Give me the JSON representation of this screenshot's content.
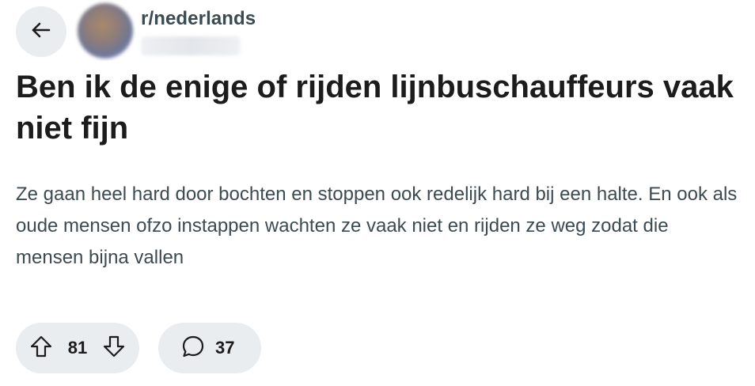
{
  "header": {
    "back_icon": "arrow-left-icon",
    "subreddit": "r/nederlands",
    "username": ""
  },
  "post": {
    "title": "Ben ik de enige of rijden lijnbuschauffeurs vaak niet fijn",
    "body": "Ze gaan heel hard door bochten en stoppen ook redelijk hard bij een halte. En ook als oude mensen ofzo instappen wachten ze vaak niet en rijden ze weg zodat die mensen bijna vallen"
  },
  "actions": {
    "upvote_icon": "arrow-up-icon",
    "downvote_icon": "arrow-down-icon",
    "vote_count": "81",
    "comment_icon": "speech-bubble-icon",
    "comment_count": "37"
  },
  "colors": {
    "pill_background": "#eaedef",
    "title_text": "#1c1c1c",
    "secondary_text": "#3c4a52"
  }
}
